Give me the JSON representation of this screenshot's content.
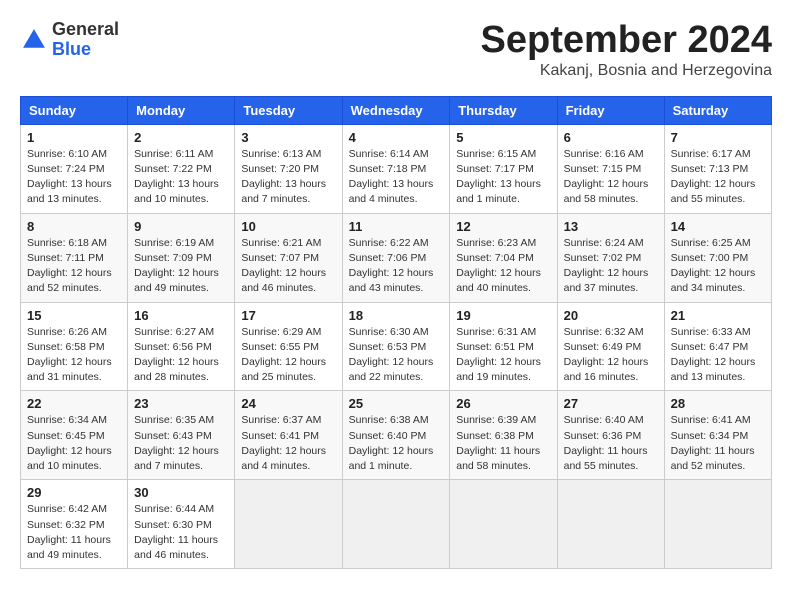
{
  "logo": {
    "general": "General",
    "blue": "Blue"
  },
  "title": "September 2024",
  "location": "Kakanj, Bosnia and Herzegovina",
  "days_of_week": [
    "Sunday",
    "Monday",
    "Tuesday",
    "Wednesday",
    "Thursday",
    "Friday",
    "Saturday"
  ],
  "weeks": [
    [
      {
        "day": "1",
        "detail": "Sunrise: 6:10 AM\nSunset: 7:24 PM\nDaylight: 13 hours\nand 13 minutes."
      },
      {
        "day": "2",
        "detail": "Sunrise: 6:11 AM\nSunset: 7:22 PM\nDaylight: 13 hours\nand 10 minutes."
      },
      {
        "day": "3",
        "detail": "Sunrise: 6:13 AM\nSunset: 7:20 PM\nDaylight: 13 hours\nand 7 minutes."
      },
      {
        "day": "4",
        "detail": "Sunrise: 6:14 AM\nSunset: 7:18 PM\nDaylight: 13 hours\nand 4 minutes."
      },
      {
        "day": "5",
        "detail": "Sunrise: 6:15 AM\nSunset: 7:17 PM\nDaylight: 13 hours\nand 1 minute."
      },
      {
        "day": "6",
        "detail": "Sunrise: 6:16 AM\nSunset: 7:15 PM\nDaylight: 12 hours\nand 58 minutes."
      },
      {
        "day": "7",
        "detail": "Sunrise: 6:17 AM\nSunset: 7:13 PM\nDaylight: 12 hours\nand 55 minutes."
      }
    ],
    [
      {
        "day": "8",
        "detail": "Sunrise: 6:18 AM\nSunset: 7:11 PM\nDaylight: 12 hours\nand 52 minutes."
      },
      {
        "day": "9",
        "detail": "Sunrise: 6:19 AM\nSunset: 7:09 PM\nDaylight: 12 hours\nand 49 minutes."
      },
      {
        "day": "10",
        "detail": "Sunrise: 6:21 AM\nSunset: 7:07 PM\nDaylight: 12 hours\nand 46 minutes."
      },
      {
        "day": "11",
        "detail": "Sunrise: 6:22 AM\nSunset: 7:06 PM\nDaylight: 12 hours\nand 43 minutes."
      },
      {
        "day": "12",
        "detail": "Sunrise: 6:23 AM\nSunset: 7:04 PM\nDaylight: 12 hours\nand 40 minutes."
      },
      {
        "day": "13",
        "detail": "Sunrise: 6:24 AM\nSunset: 7:02 PM\nDaylight: 12 hours\nand 37 minutes."
      },
      {
        "day": "14",
        "detail": "Sunrise: 6:25 AM\nSunset: 7:00 PM\nDaylight: 12 hours\nand 34 minutes."
      }
    ],
    [
      {
        "day": "15",
        "detail": "Sunrise: 6:26 AM\nSunset: 6:58 PM\nDaylight: 12 hours\nand 31 minutes."
      },
      {
        "day": "16",
        "detail": "Sunrise: 6:27 AM\nSunset: 6:56 PM\nDaylight: 12 hours\nand 28 minutes."
      },
      {
        "day": "17",
        "detail": "Sunrise: 6:29 AM\nSunset: 6:55 PM\nDaylight: 12 hours\nand 25 minutes."
      },
      {
        "day": "18",
        "detail": "Sunrise: 6:30 AM\nSunset: 6:53 PM\nDaylight: 12 hours\nand 22 minutes."
      },
      {
        "day": "19",
        "detail": "Sunrise: 6:31 AM\nSunset: 6:51 PM\nDaylight: 12 hours\nand 19 minutes."
      },
      {
        "day": "20",
        "detail": "Sunrise: 6:32 AM\nSunset: 6:49 PM\nDaylight: 12 hours\nand 16 minutes."
      },
      {
        "day": "21",
        "detail": "Sunrise: 6:33 AM\nSunset: 6:47 PM\nDaylight: 12 hours\nand 13 minutes."
      }
    ],
    [
      {
        "day": "22",
        "detail": "Sunrise: 6:34 AM\nSunset: 6:45 PM\nDaylight: 12 hours\nand 10 minutes."
      },
      {
        "day": "23",
        "detail": "Sunrise: 6:35 AM\nSunset: 6:43 PM\nDaylight: 12 hours\nand 7 minutes."
      },
      {
        "day": "24",
        "detail": "Sunrise: 6:37 AM\nSunset: 6:41 PM\nDaylight: 12 hours\nand 4 minutes."
      },
      {
        "day": "25",
        "detail": "Sunrise: 6:38 AM\nSunset: 6:40 PM\nDaylight: 12 hours\nand 1 minute."
      },
      {
        "day": "26",
        "detail": "Sunrise: 6:39 AM\nSunset: 6:38 PM\nDaylight: 11 hours\nand 58 minutes."
      },
      {
        "day": "27",
        "detail": "Sunrise: 6:40 AM\nSunset: 6:36 PM\nDaylight: 11 hours\nand 55 minutes."
      },
      {
        "day": "28",
        "detail": "Sunrise: 6:41 AM\nSunset: 6:34 PM\nDaylight: 11 hours\nand 52 minutes."
      }
    ],
    [
      {
        "day": "29",
        "detail": "Sunrise: 6:42 AM\nSunset: 6:32 PM\nDaylight: 11 hours\nand 49 minutes."
      },
      {
        "day": "30",
        "detail": "Sunrise: 6:44 AM\nSunset: 6:30 PM\nDaylight: 11 hours\nand 46 minutes."
      },
      {
        "day": "",
        "detail": ""
      },
      {
        "day": "",
        "detail": ""
      },
      {
        "day": "",
        "detail": ""
      },
      {
        "day": "",
        "detail": ""
      },
      {
        "day": "",
        "detail": ""
      }
    ]
  ]
}
